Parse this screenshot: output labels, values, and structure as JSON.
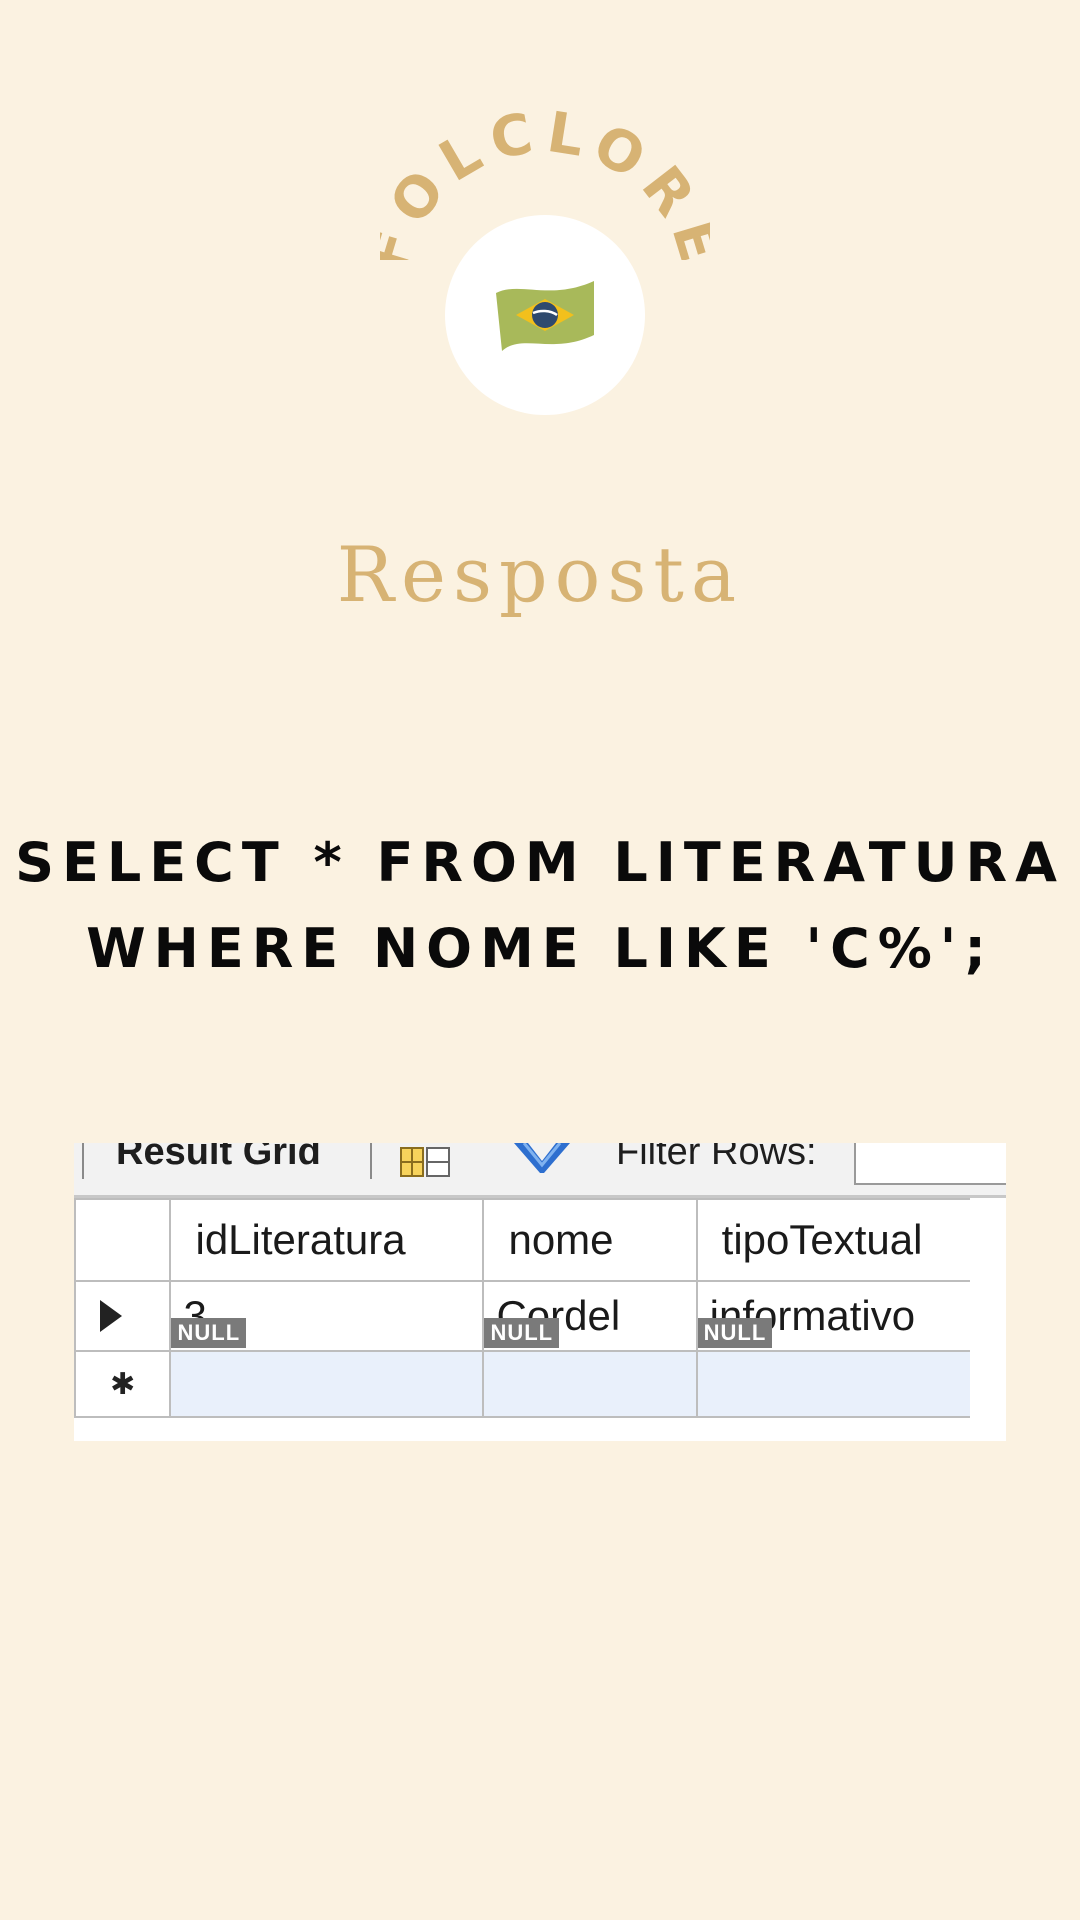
{
  "logo": {
    "arc_text": "FOLCLORE",
    "icon": "brazil-flag-icon"
  },
  "heading": "Resposta",
  "sql": {
    "line1": "SELECT * FROM LITERATURA",
    "line2": "WHERE NOME LIKE 'C%';"
  },
  "result_grid": {
    "tab_label": "Result Grid",
    "filter_label": "Filter Rows:",
    "filter_value": "",
    "columns": [
      "idLiteratura",
      "nome",
      "tipoTextual"
    ],
    "rows": [
      {
        "idLiteratura": "3",
        "nome": "Cordel",
        "tipoTextual": "informativo"
      }
    ],
    "new_row": {
      "idLiteratura": "NULL",
      "nome": "NULL",
      "tipoTextual": "NULL"
    }
  },
  "colors": {
    "background": "#fbf2e1",
    "accent": "#d7b374",
    "text": "#0a0a0a"
  }
}
